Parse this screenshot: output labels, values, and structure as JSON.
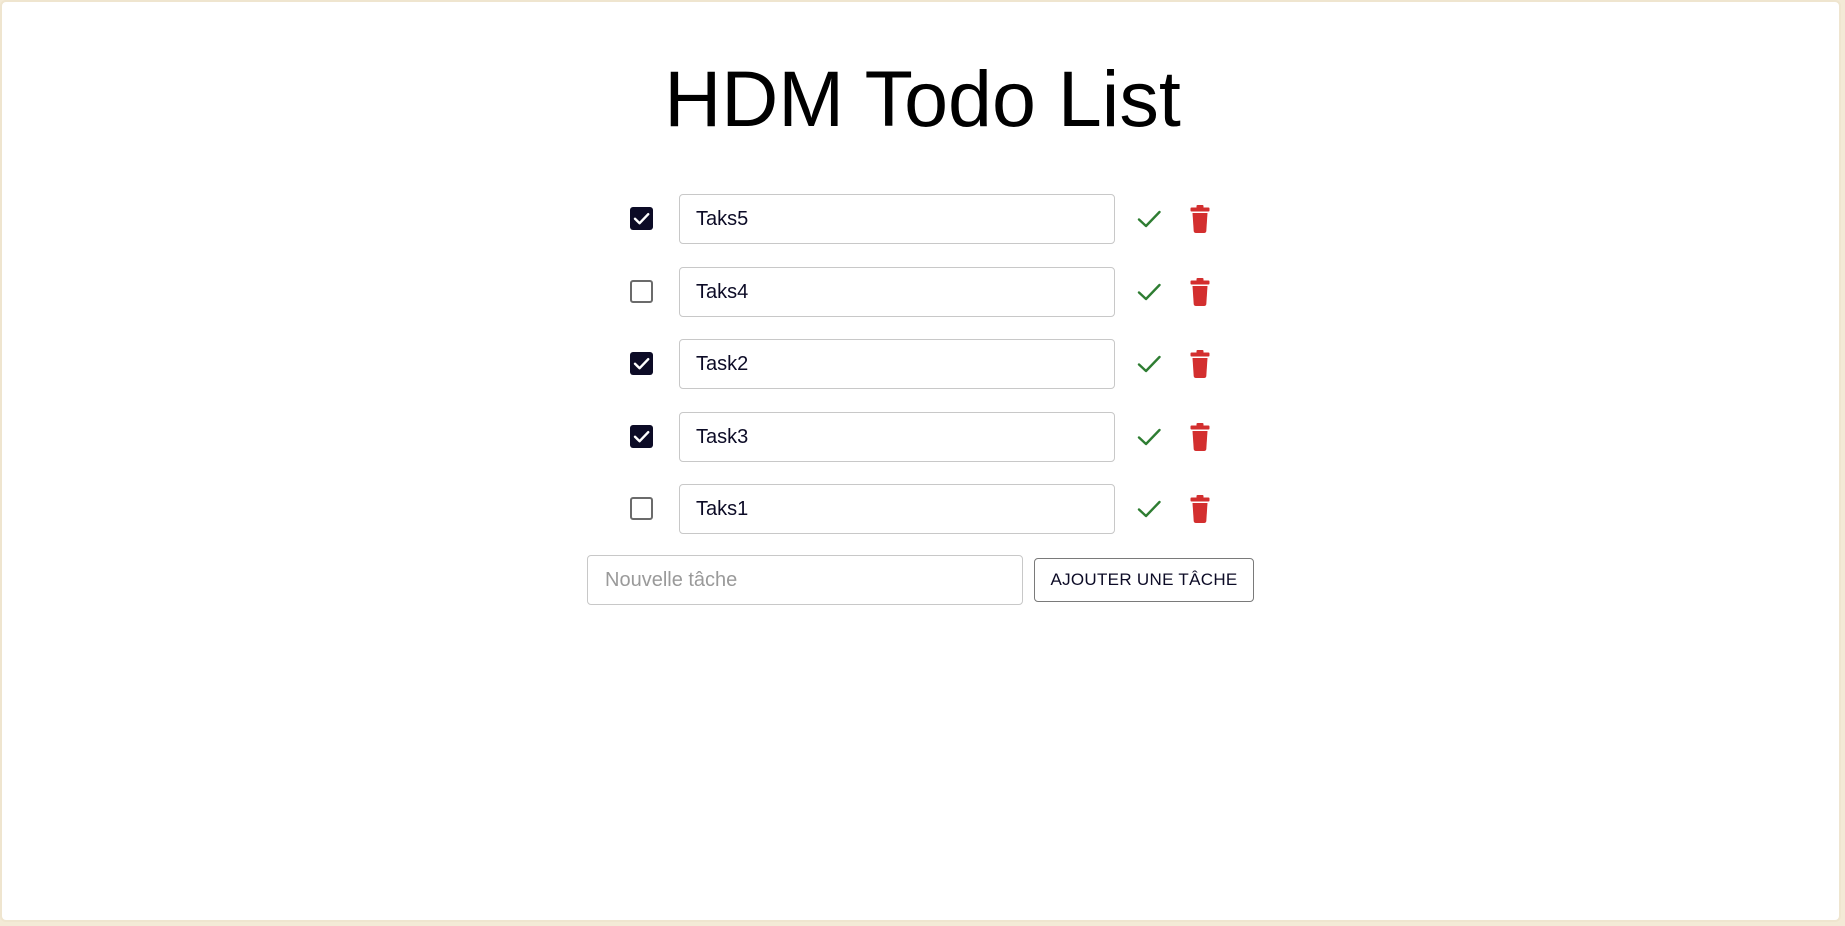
{
  "app": {
    "title": "HDM Todo List"
  },
  "colors": {
    "checked_fill": "#0c0b26",
    "confirm_icon": "#2e7d32",
    "delete_icon": "#d32f2f"
  },
  "icons": {
    "checkbox_checked": "checkbox-checked-icon",
    "checkbox_unchecked": "checkbox-unchecked-icon",
    "confirm": "check-icon",
    "delete": "trash-icon"
  },
  "tasks": [
    {
      "value": "Taks5",
      "checked": true
    },
    {
      "value": "Taks4",
      "checked": false
    },
    {
      "value": "Task2",
      "checked": true
    },
    {
      "value": "Task3",
      "checked": true
    },
    {
      "value": "Taks1",
      "checked": false
    }
  ],
  "new_task": {
    "value": "",
    "placeholder": "Nouvelle tâche"
  },
  "add_button": {
    "label": "AJOUTER UNE TÂCHE"
  }
}
